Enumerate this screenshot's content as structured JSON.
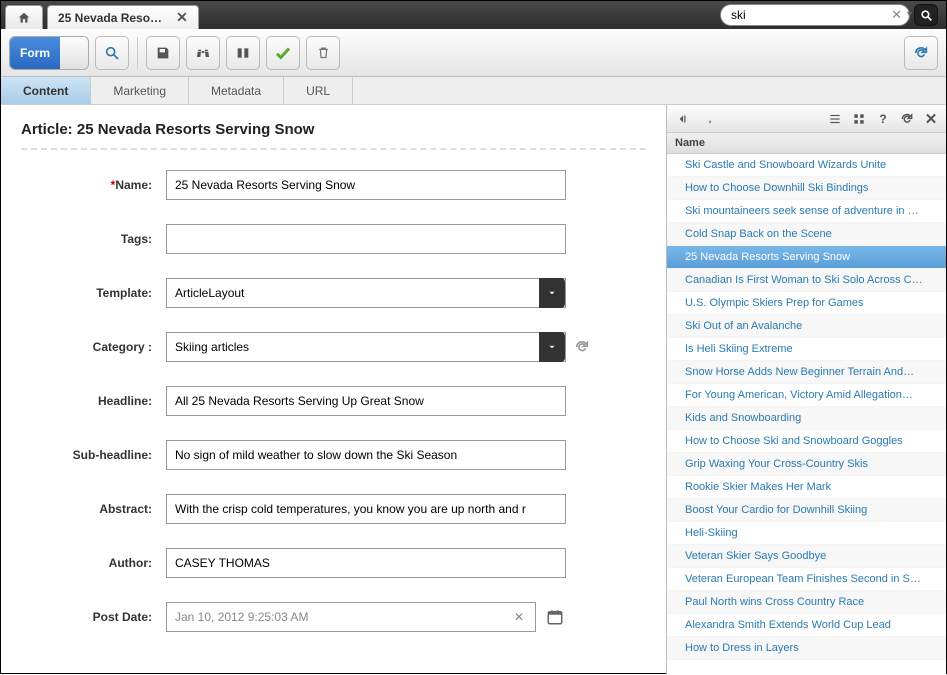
{
  "topbar": {
    "tab_title": "25 Nevada Reso…",
    "search_value": "ski"
  },
  "toolbar": {
    "form_label": "Form"
  },
  "content_tabs": [
    "Content",
    "Marketing",
    "Metadata",
    "URL"
  ],
  "article": {
    "heading": "Article: 25 Nevada Resorts Serving Snow",
    "fields": {
      "name_label": "Name:",
      "name_value": "25 Nevada Resorts Serving Snow",
      "tags_label": "Tags:",
      "tags_value": "",
      "template_label": "Template:",
      "template_value": "ArticleLayout",
      "category_label": "Category :",
      "category_value": "Skiing articles",
      "headline_label": "Headline:",
      "headline_value": "All 25 Nevada Resorts Serving Up Great Snow",
      "subheadline_label": "Sub-headline:",
      "subheadline_value": "No sign of mild weather to slow down the Ski Season",
      "abstract_label": "Abstract:",
      "abstract_value": "With the crisp cold temperatures, you know you are up north and r",
      "author_label": "Author:",
      "author_value": "CASEY THOMAS",
      "postdate_label": "Post Date:",
      "postdate_value": "Jan 10, 2012 9:25:03 AM"
    }
  },
  "right_panel": {
    "header": "Name",
    "items": [
      "Ski Castle and Snowboard Wizards Unite",
      "How to Choose Downhill Ski Bindings",
      "Ski mountaineers seek sense of adventure in …",
      "Cold Snap Back on the Scene",
      "25 Nevada Resorts Serving Snow",
      "Canadian Is First Woman to Ski Solo Across C…",
      "U.S. Olympic Skiers Prep for Games",
      "Ski Out of an Avalanche",
      "Is Heli Skiing Extreme",
      "Snow Horse Adds New Beginner Terrain And…",
      "For Young American, Victory Amid Allegation…",
      "Kids and Snowboarding",
      "How to Choose Ski and Snowboard Goggles",
      "Grip Waxing Your Cross-Country Skis",
      "Rookie Skier Makes Her Mark",
      "Boost Your Cardio for Downhill Skiing",
      "Heli-Skiing",
      "Veteran Skier Says Goodbye",
      "Veteran European Team Finishes Second in S…",
      "Paul North wins Cross Country Race",
      "Alexandra Smith Extends World Cup Lead",
      "How to Dress in Layers"
    ],
    "selected_index": 4
  }
}
